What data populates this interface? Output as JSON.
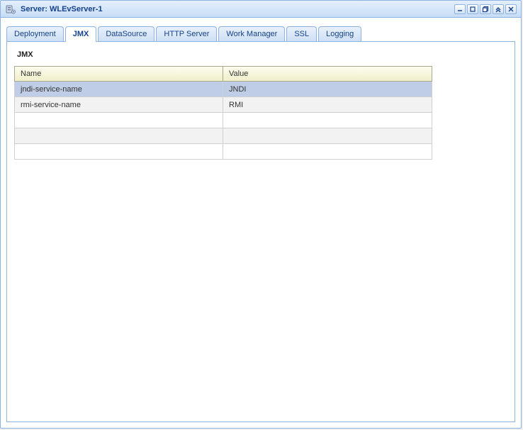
{
  "header": {
    "title_prefix": "Server:",
    "server_name": "WLEvServer-1"
  },
  "tabs": [
    {
      "label": "Deployment",
      "active": false
    },
    {
      "label": "JMX",
      "active": true
    },
    {
      "label": "DataSource",
      "active": false
    },
    {
      "label": "HTTP Server",
      "active": false
    },
    {
      "label": "Work Manager",
      "active": false
    },
    {
      "label": "SSL",
      "active": false
    },
    {
      "label": "Logging",
      "active": false
    }
  ],
  "panel": {
    "section_title": "JMX",
    "columns": {
      "name": "Name",
      "value": "Value"
    },
    "rows": [
      {
        "name": "jndi-service-name",
        "value": "JNDI"
      },
      {
        "name": "rmi-service-name",
        "value": "RMI"
      },
      {
        "name": "",
        "value": ""
      },
      {
        "name": "",
        "value": ""
      },
      {
        "name": "",
        "value": ""
      }
    ]
  }
}
